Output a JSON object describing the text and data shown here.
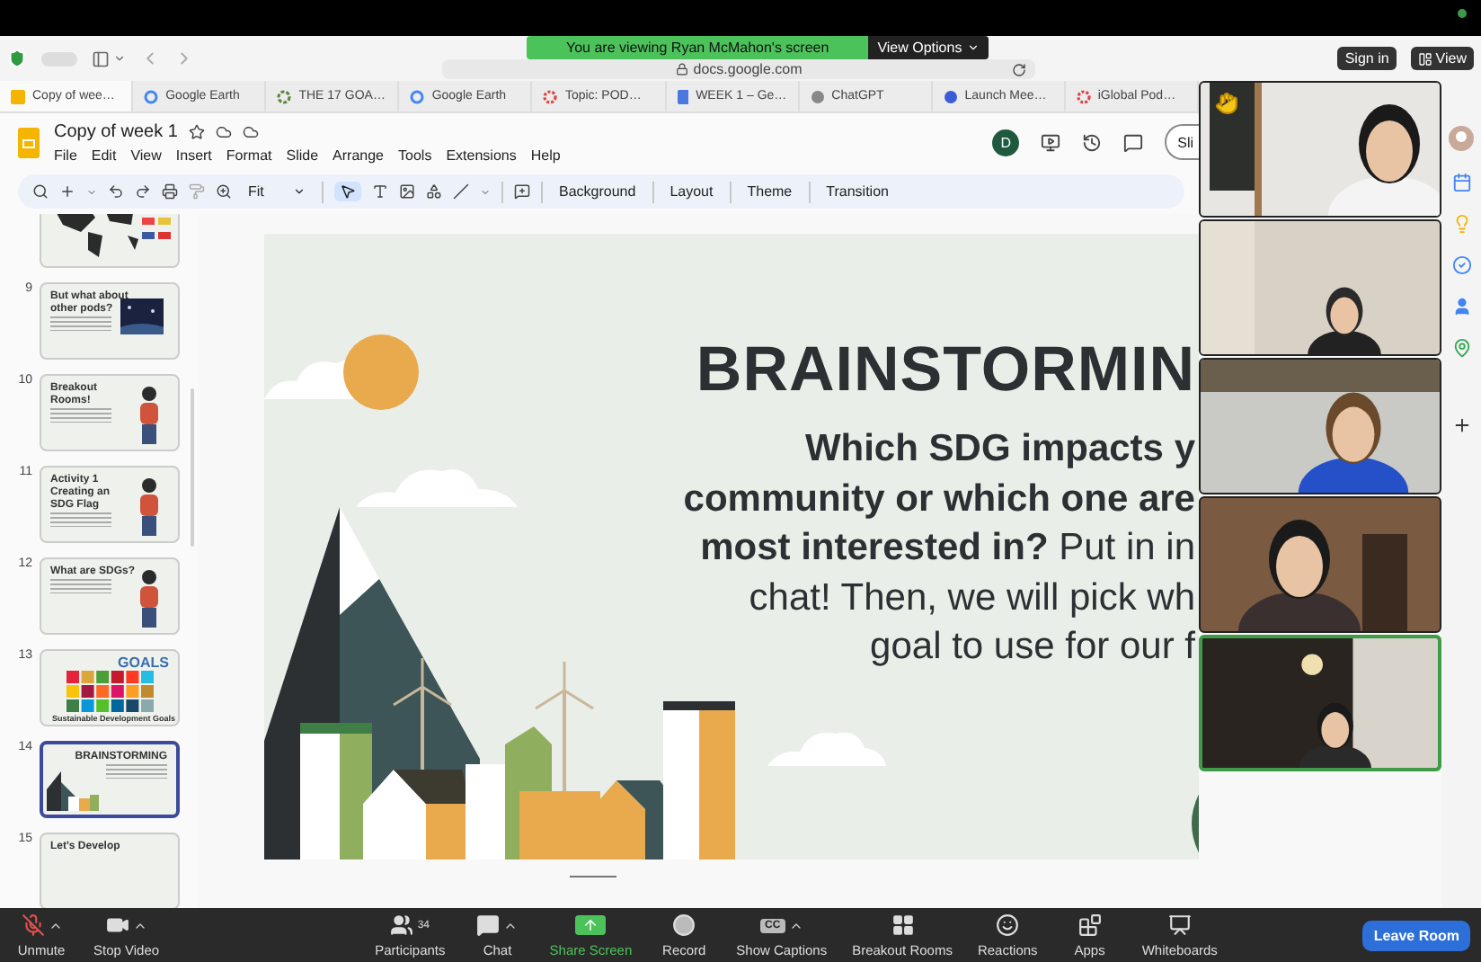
{
  "meeting_banner": {
    "text": "You are viewing Ryan McMahon's screen",
    "options": "View Options"
  },
  "zoom_corner_buttons": [
    {
      "kind": "signin",
      "label": "Sign in"
    },
    {
      "kind": "view",
      "label": "View"
    }
  ],
  "browser": {
    "url": "docs.google.com",
    "tabs": [
      {
        "label": "Copy of wee…",
        "kind": "slides",
        "selected": true
      },
      {
        "label": "Google Earth",
        "kind": "google",
        "selected": false
      },
      {
        "label": "THE 17 GOA…",
        "kind": "ring",
        "selected": false
      },
      {
        "label": "Google Earth",
        "kind": "google",
        "selected": false
      },
      {
        "label": "Topic: POD…",
        "kind": "gear",
        "selected": false
      },
      {
        "label": "WEEK 1 – Ge…",
        "kind": "docs",
        "selected": false
      },
      {
        "label": "ChatGPT",
        "kind": "chatgpt",
        "selected": false
      },
      {
        "label": "Launch Mee…",
        "kind": "meet",
        "selected": false
      },
      {
        "label": "iGlobal Pod…",
        "kind": "gear",
        "selected": false
      }
    ]
  },
  "document": {
    "title": "Copy of week 1",
    "menu": [
      "File",
      "Edit",
      "View",
      "Insert",
      "Format",
      "Slide",
      "Arrange",
      "Tools",
      "Extensions",
      "Help"
    ],
    "user_initial": "D",
    "slideshow_button": "Sli",
    "zoom": "Fit",
    "toolbar_buttons": [
      "Background",
      "Layout",
      "Theme",
      "Transition"
    ]
  },
  "slides": [
    {
      "kind": "map",
      "selected": false
    },
    {
      "number": "9",
      "kind": "screen",
      "title": [
        "But what about",
        "other pods?"
      ],
      "selected": false
    },
    {
      "number": "10",
      "kind": "figure",
      "title": [
        "Breakout",
        "Rooms!"
      ],
      "selected": false
    },
    {
      "number": "11",
      "kind": "figure",
      "title": [
        "Activity 1",
        "Creating an",
        "SDG Flag"
      ],
      "selected": false
    },
    {
      "number": "12",
      "kind": "figure",
      "title": [
        "What are SDGs?"
      ],
      "selected": false
    },
    {
      "number": "13",
      "kind": "grid",
      "title": [
        "GOALS"
      ],
      "caption": "Sustainable Development Goals",
      "selected": false
    },
    {
      "number": "14",
      "kind": "city",
      "title": [
        "BRAINSTORMING"
      ],
      "selected": true
    },
    {
      "number": "15",
      "kind": "text",
      "title": [
        "Let's Develop"
      ],
      "selected": false
    }
  ],
  "current_slide": {
    "title": "BRAINSTORMIN",
    "lines": [
      "**Which SDG impacts y**",
      "**community or which one are**",
      "**most interested in?** Put in in",
      "chat! Then, we will pick wh",
      "goal to use for our f"
    ]
  },
  "video_tiles": [
    {
      "kind": "picture",
      "hand_raised": true,
      "active_speaker": false
    },
    {
      "kind": "picture",
      "hand_raised": false,
      "active_speaker": false
    },
    {
      "kind": "picture",
      "hand_raised": false,
      "active_speaker": false
    },
    {
      "kind": "picture",
      "hand_raised": false,
      "active_speaker": false
    },
    {
      "kind": "picture",
      "hand_raised": false,
      "active_speaker": true
    }
  ],
  "meeting_controls": [
    {
      "kind": "mic",
      "label": "Unmute",
      "muted": true,
      "caret": true
    },
    {
      "kind": "video",
      "label": "Stop Video",
      "caret": true
    },
    {
      "kind": "participants",
      "label": "Participants",
      "count": "34",
      "caret": false
    },
    {
      "kind": "chat",
      "label": "Chat",
      "caret": true
    },
    {
      "kind": "share",
      "label": "Share Screen",
      "caret": false
    },
    {
      "kind": "record",
      "label": "Record",
      "caret": false
    },
    {
      "kind": "captions",
      "label": "Show Captions",
      "icon_text": "CC",
      "caret": true
    },
    {
      "kind": "breakout",
      "label": "Breakout Rooms",
      "caret": false
    },
    {
      "kind": "reactions",
      "label": "Reactions",
      "caret": false
    },
    {
      "kind": "apps",
      "label": "Apps",
      "caret": false
    },
    {
      "kind": "whiteboards",
      "label": "Whiteboards",
      "caret": false
    }
  ],
  "leave_button": "Leave Room"
}
